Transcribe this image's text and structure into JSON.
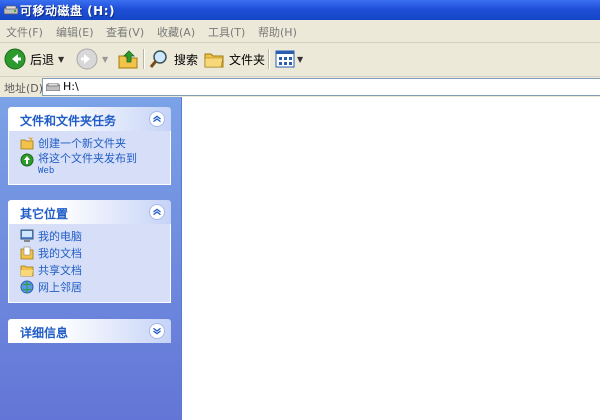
{
  "window": {
    "title": "可移动磁盘 (H:)"
  },
  "menu": [
    {
      "label": "文件(F)"
    },
    {
      "label": "编辑(E)"
    },
    {
      "label": "查看(V)"
    },
    {
      "label": "收藏(A)"
    },
    {
      "label": "工具(T)"
    },
    {
      "label": "帮助(H)"
    }
  ],
  "toolbar": {
    "back_label": "后退",
    "search_label": "搜索",
    "folders_label": "文件夹"
  },
  "address": {
    "label": "地址(D)",
    "value": "H:\\"
  },
  "panels": {
    "tasks": {
      "title": "文件和文件夹任务",
      "items": [
        {
          "label": "创建一个新文件夹"
        },
        {
          "label": "将这个文件夹发布到",
          "sub": "Web"
        }
      ]
    },
    "places": {
      "title": "其它位置",
      "items": [
        {
          "label": "我的电脑"
        },
        {
          "label": "我的文档"
        },
        {
          "label": "共享文档"
        },
        {
          "label": "网上邻居"
        }
      ]
    },
    "details": {
      "title": "详细信息"
    }
  },
  "colors": {
    "title_bar": "#1f4fd8",
    "link_text": "#215dc6",
    "pane_bg": "#7ba2e7"
  }
}
